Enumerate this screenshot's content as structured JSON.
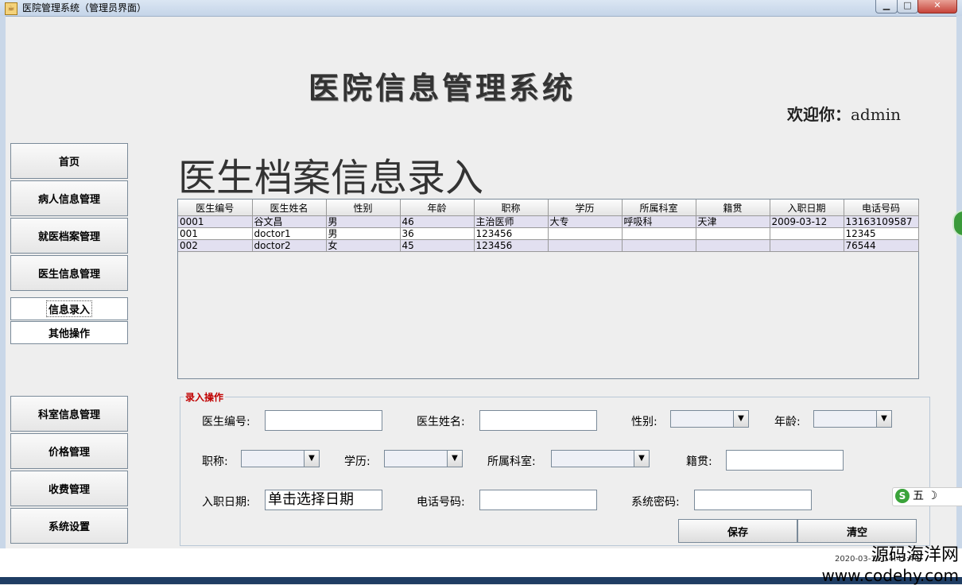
{
  "window": {
    "title": "医院管理系统（管理员界面）"
  },
  "header": {
    "title": "医院信息管理系统",
    "welcome_label": "欢迎你：",
    "username": "admin"
  },
  "sidebar": {
    "top_items": [
      "首页",
      "病人信息管理",
      "就医档案管理",
      "医生信息管理"
    ],
    "sub_items": [
      "信息录入",
      "其他操作"
    ],
    "bottom_items": [
      "科室信息管理",
      "价格管理",
      "收费管理",
      "系统设置"
    ]
  },
  "page": {
    "title": "医生档案信息录入"
  },
  "table": {
    "columns": [
      "医生编号",
      "医生姓名",
      "性别",
      "年龄",
      "职称",
      "学历",
      "所属科室",
      "籍贯",
      "入职日期",
      "电话号码"
    ],
    "rows": [
      [
        "0001",
        "谷文昌",
        "男",
        "46",
        "主治医师",
        "大专",
        "呼吸科",
        "天津",
        "2009-03-12",
        "13163109587"
      ],
      [
        "001",
        "doctor1",
        "男",
        "36",
        "123456",
        "",
        "",
        "",
        "",
        "12345"
      ],
      [
        "002",
        "doctor2",
        "女",
        "45",
        "123456",
        "",
        "",
        "",
        "",
        "76544"
      ]
    ]
  },
  "form": {
    "legend": "录入操作",
    "doctor_id_label": "医生编号:",
    "doctor_name_label": "医生姓名:",
    "gender_label": "性别:",
    "age_label": "年龄:",
    "title_label": "职称:",
    "education_label": "学历:",
    "department_label": "所属科室:",
    "hometown_label": "籍贯:",
    "hire_date_label": "入职日期:",
    "hire_date_value": "单击选择日期",
    "phone_label": "电话号码:",
    "password_label": "系统密码:",
    "save_label": "保存",
    "clear_label": "清空"
  },
  "overlay": {
    "watermark_line1": "源码海洋网",
    "watermark_line2": "www.codehy.com",
    "timestamp": "2020-03-11 14:45:40",
    "ime_label": "五"
  }
}
